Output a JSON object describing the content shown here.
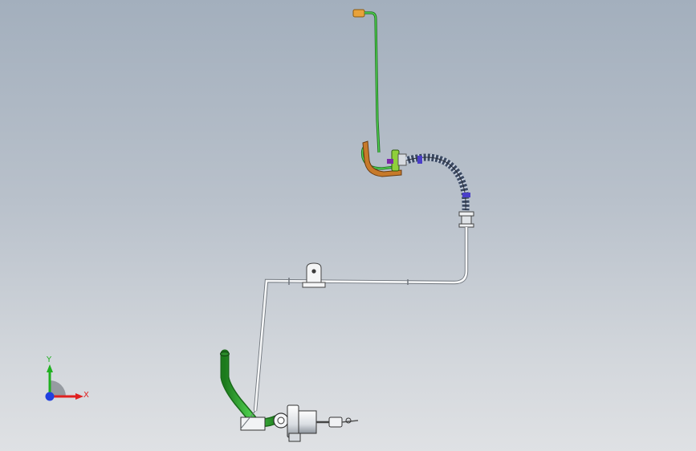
{
  "triad": {
    "x_label": "X",
    "y_label": "Y"
  },
  "colors": {
    "background_top": "#a3afbd",
    "background_bottom": "#dfe1e4",
    "hose_green": "#2fa12f",
    "tube_white": "#f2f4f6",
    "bracket_orange": "#c77a2a",
    "axis_x": "#e02020",
    "axis_y": "#20b020",
    "axis_z": "#2040e0"
  },
  "icons": [
    "coordinate-triad-icon"
  ]
}
